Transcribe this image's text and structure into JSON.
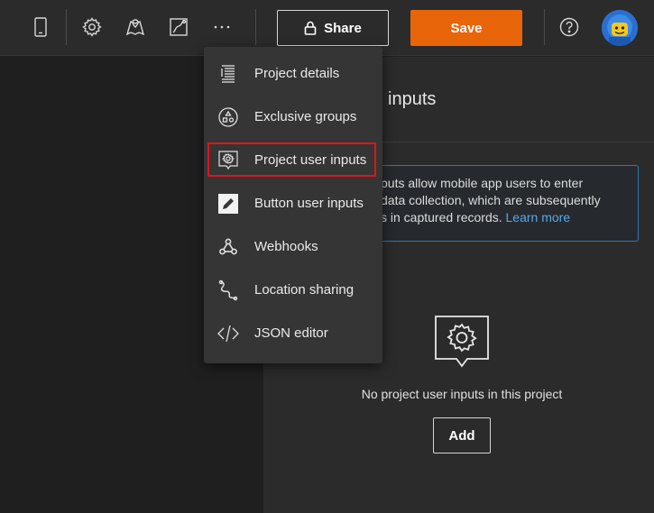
{
  "toolbar": {
    "icons": [
      "mobile-device-icon",
      "gear-icon",
      "map-pin-icon",
      "map-route-icon",
      "more-icon",
      "help-icon"
    ],
    "share_label": "Share",
    "save_label": "Save",
    "accent_color": "#e8650a"
  },
  "menu": {
    "items": [
      {
        "label": "Project details",
        "icon": "document-list-icon"
      },
      {
        "label": "Exclusive groups",
        "icon": "shapes-group-icon"
      },
      {
        "label": "Project user inputs",
        "icon": "gear-callout-icon",
        "highlighted": true
      },
      {
        "label": "Button user inputs",
        "icon": "pencil-icon"
      },
      {
        "label": "Webhooks",
        "icon": "webhook-icon"
      },
      {
        "label": "Location sharing",
        "icon": "location-trail-icon"
      },
      {
        "label": "JSON editor",
        "icon": "code-brackets-icon"
      }
    ]
  },
  "main": {
    "title_visible": "inputs",
    "notice_text": "puts allow mobile app users to enter data collection, which are subsequently s in captured records.",
    "notice_line1": "puts allow mobile app users to enter",
    "notice_line2": "data collection, which are subsequently",
    "notice_line3": "s in captured records.",
    "learn_more": "Learn more",
    "empty_message": "No project user inputs in this project",
    "add_label": "Add"
  }
}
